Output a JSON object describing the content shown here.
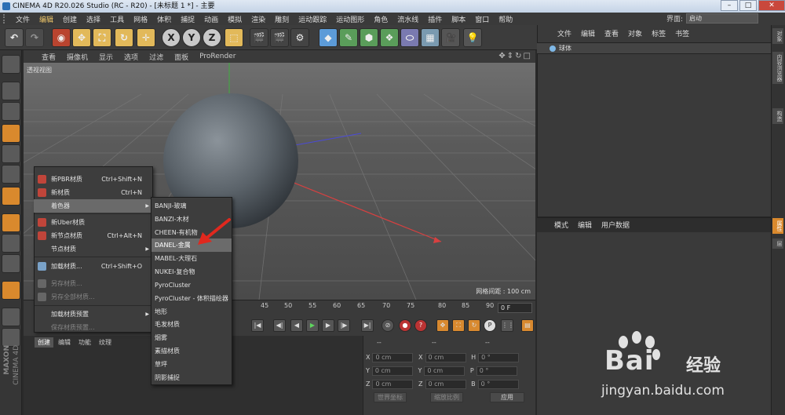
{
  "window": {
    "title": "CINEMA 4D R20.026 Studio (RC - R20) - [未标题 1 *] - 主要"
  },
  "menubar": {
    "items": [
      "文件",
      "编辑",
      "创建",
      "选择",
      "工具",
      "网格",
      "体积",
      "捕捉",
      "动画",
      "模拟",
      "渲染",
      "雕刻",
      "运动跟踪",
      "运动图形",
      "角色",
      "流水线",
      "插件",
      "脚本",
      "窗口",
      "帮助"
    ],
    "layout_label": "界面:",
    "layout_value": "启动"
  },
  "viewport": {
    "menu": [
      "查看",
      "摄像机",
      "显示",
      "选项",
      "过滤",
      "面板",
      "ProRender"
    ],
    "label": "透视视图",
    "grid_spacing": "网格间距 : 100 cm"
  },
  "timeline": {
    "ticks": [
      "45",
      "50",
      "55",
      "60",
      "65",
      "70",
      "75",
      "80",
      "85",
      "90"
    ],
    "frame": "0 F"
  },
  "material_panel": {
    "tabs": [
      "创建",
      "编辑",
      "功能",
      "纹理"
    ]
  },
  "coordinates": {
    "headers": [
      "--",
      "--",
      "--"
    ],
    "rows": [
      {
        "a": "X",
        "av": "0 cm",
        "b": "X",
        "bv": "0 cm",
        "c": "H",
        "cv": "0 °"
      },
      {
        "a": "Y",
        "av": "0 cm",
        "b": "Y",
        "bv": "0 cm",
        "c": "P",
        "cv": "0 °"
      },
      {
        "a": "Z",
        "av": "0 cm",
        "b": "Z",
        "bv": "0 cm",
        "c": "B",
        "cv": "0 °"
      }
    ],
    "world_button": "世界坐标",
    "scale_button": "缩放比例",
    "apply_button": "应用"
  },
  "object_manager": {
    "menu": [
      "文件",
      "编辑",
      "查看",
      "对象",
      "标签",
      "书签"
    ],
    "object_name": "球体"
  },
  "attribute_manager": {
    "menu": [
      "模式",
      "编辑",
      "用户数据"
    ]
  },
  "right_tabs": [
    "对象",
    "内容浏览器",
    "构造",
    "属性",
    "层"
  ],
  "context_menu": {
    "items": [
      {
        "label": "新PBR材质",
        "shortcut": "Ctrl+Shift+N"
      },
      {
        "label": "新材质",
        "shortcut": "Ctrl+N"
      },
      {
        "label": "着色器",
        "shortcut": ""
      },
      {
        "label": "新Uber材质",
        "shortcut": ""
      },
      {
        "label": "新节点材质",
        "shortcut": "Ctrl+Alt+N"
      },
      {
        "label": "节点材质",
        "shortcut": ""
      },
      {
        "label": "加载材质...",
        "shortcut": "Ctrl+Shift+O"
      },
      {
        "label": "另存材质...",
        "shortcut": ""
      },
      {
        "label": "另存全部材质...",
        "shortcut": ""
      },
      {
        "label": "加载材质预置",
        "shortcut": ""
      },
      {
        "label": "保存材质预置...",
        "shortcut": ""
      }
    ]
  },
  "shader_submenu": {
    "items": [
      "BANJI-玻璃",
      "BANZI-木材",
      "CHEEN-有机物",
      "DANEL-金属",
      "MABEL-大理石",
      "NUKEI-复合物",
      "PyroCluster",
      "PyroCluster - 体积描绘器",
      "地形",
      "毛发材质",
      "烟雾",
      "素描材质",
      "草坪",
      "阴影捕捉"
    ],
    "highlighted": "DANEL-金属"
  },
  "watermark": {
    "brand_text": "Bai",
    "brand_text2": "经验",
    "url": "jingyan.baidu.com"
  },
  "maxon": {
    "line1": "MAXON",
    "line2": "CINEMA 4D"
  }
}
